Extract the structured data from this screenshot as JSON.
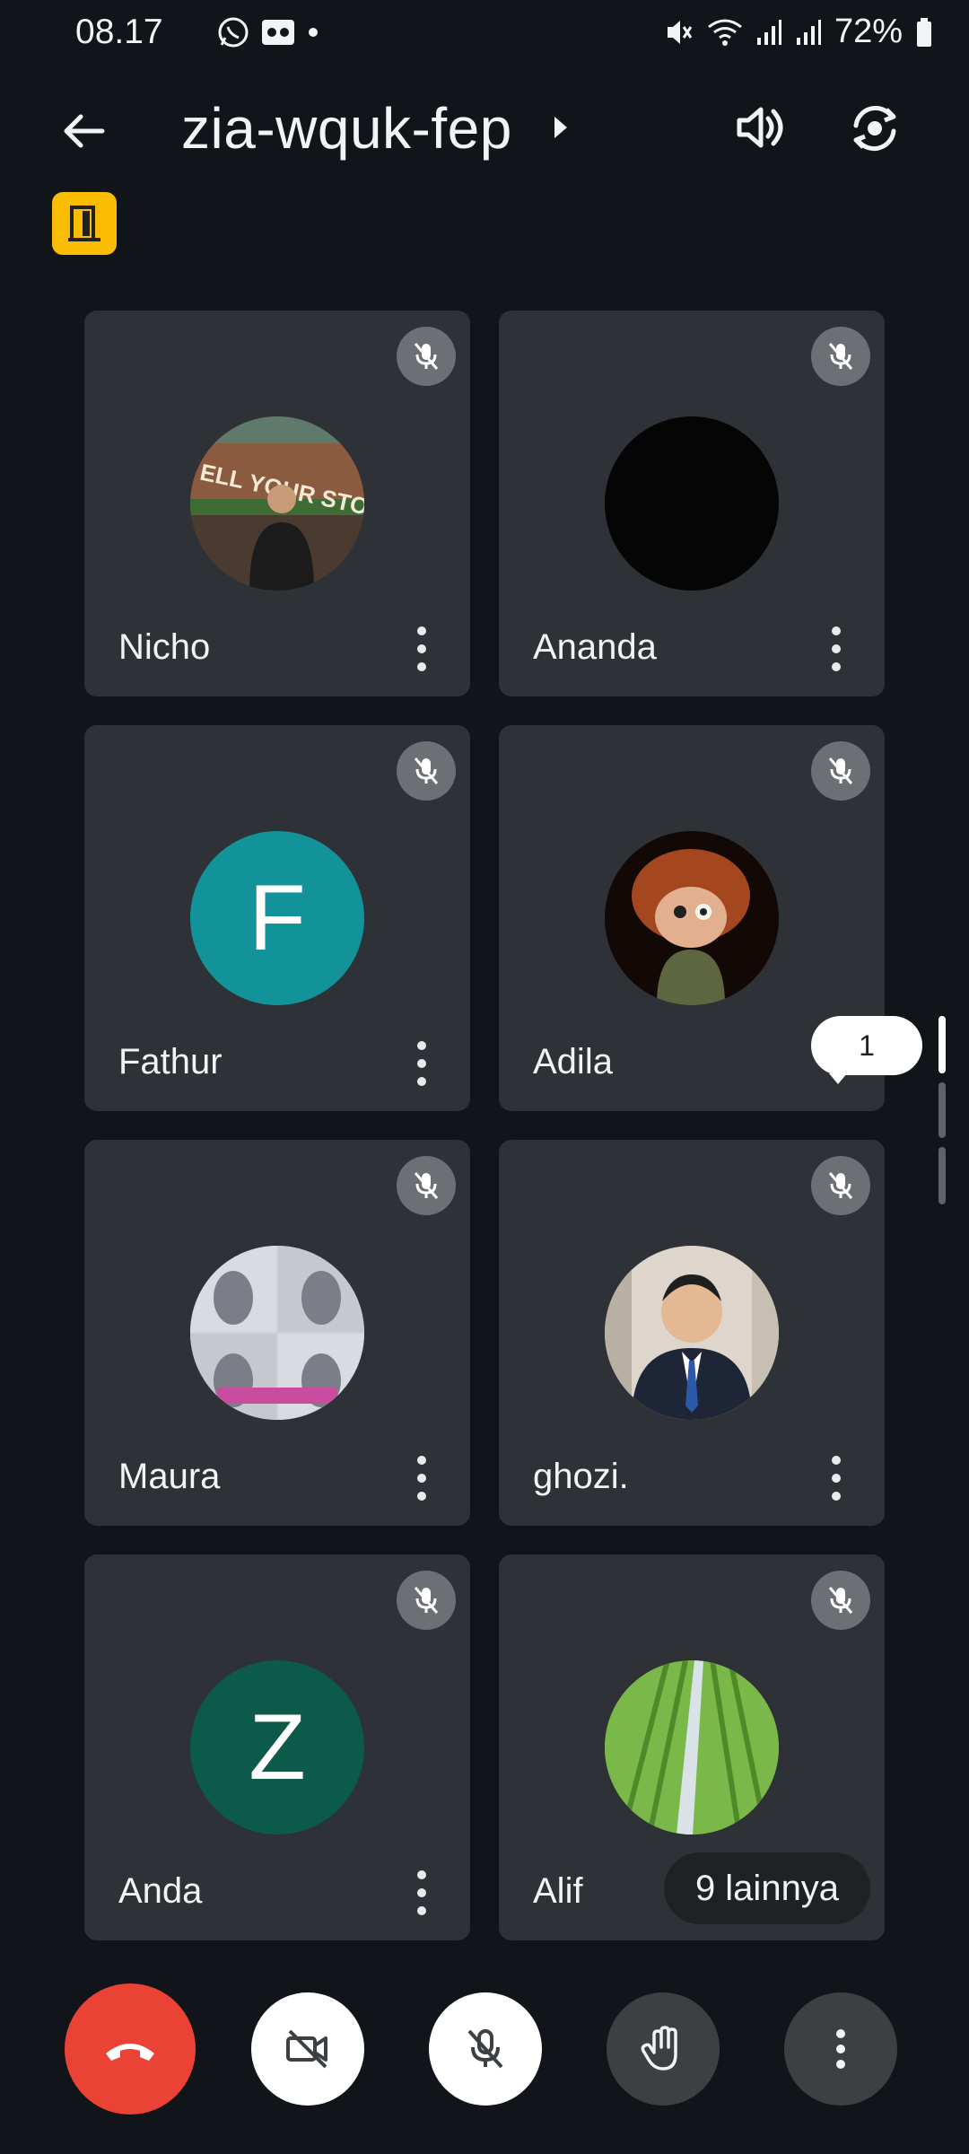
{
  "status_bar": {
    "time": "08.17",
    "battery": "72%",
    "icons": [
      "whatsapp-icon",
      "voicemail-icon",
      "dot-icon",
      "mute-icon",
      "wifi-icon",
      "signal-icon",
      "signal-icon",
      "battery-icon"
    ]
  },
  "header": {
    "meeting_code": "zia-wquk-fep",
    "icons": [
      "back-arrow-icon",
      "caret-right-icon",
      "speaker-icon",
      "switch-camera-icon"
    ]
  },
  "host_badge": {
    "icon": "door-icon",
    "color": "#fbbc04"
  },
  "participants": [
    {
      "name": "Nicho",
      "avatar": "photo",
      "muted": true
    },
    {
      "name": "Ananda",
      "avatar": "photo",
      "muted": true
    },
    {
      "name": "Fathur",
      "avatar": "initial",
      "initial": "F",
      "color": "#12939a",
      "muted": true
    },
    {
      "name": "Adila",
      "avatar": "photo",
      "muted": true
    },
    {
      "name": "Maura",
      "avatar": "photo",
      "muted": true
    },
    {
      "name": "ghozi.",
      "avatar": "photo",
      "muted": true
    },
    {
      "name": "Anda",
      "avatar": "initial",
      "initial": "Z",
      "color": "#0b5a4a",
      "muted": true
    },
    {
      "name": "Alif",
      "avatar": "photo",
      "muted": true
    }
  ],
  "more_participants_label": "9 lainnya",
  "page_bubble": "1",
  "controls": [
    {
      "id": "end-call",
      "icon": "phone-hangup-icon",
      "color": "#ea4335"
    },
    {
      "id": "camera",
      "icon": "video-off-icon"
    },
    {
      "id": "mic",
      "icon": "mic-off-icon"
    },
    {
      "id": "raise-hand",
      "icon": "hand-icon"
    },
    {
      "id": "more",
      "icon": "more-vertical-icon"
    }
  ]
}
